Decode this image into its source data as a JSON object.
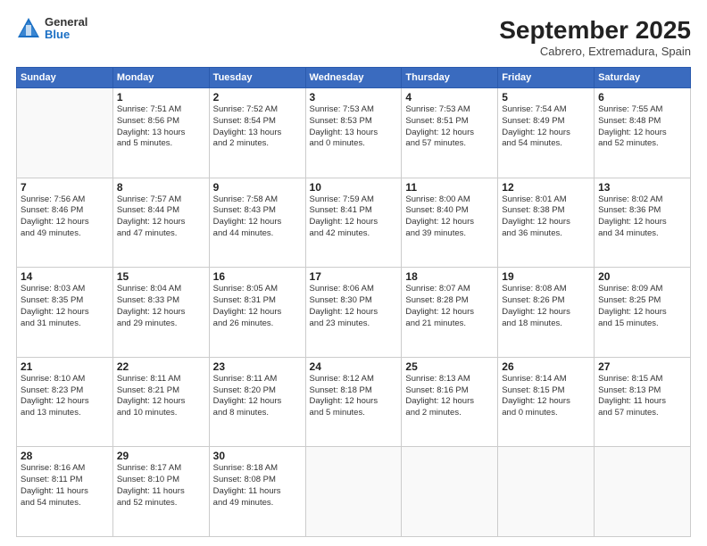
{
  "header": {
    "logo_general": "General",
    "logo_blue": "Blue",
    "month_title": "September 2025",
    "location": "Cabrero, Extremadura, Spain"
  },
  "days_of_week": [
    "Sunday",
    "Monday",
    "Tuesday",
    "Wednesday",
    "Thursday",
    "Friday",
    "Saturday"
  ],
  "weeks": [
    [
      {
        "day": "",
        "info": ""
      },
      {
        "day": "1",
        "info": "Sunrise: 7:51 AM\nSunset: 8:56 PM\nDaylight: 13 hours\nand 5 minutes."
      },
      {
        "day": "2",
        "info": "Sunrise: 7:52 AM\nSunset: 8:54 PM\nDaylight: 13 hours\nand 2 minutes."
      },
      {
        "day": "3",
        "info": "Sunrise: 7:53 AM\nSunset: 8:53 PM\nDaylight: 13 hours\nand 0 minutes."
      },
      {
        "day": "4",
        "info": "Sunrise: 7:53 AM\nSunset: 8:51 PM\nDaylight: 12 hours\nand 57 minutes."
      },
      {
        "day": "5",
        "info": "Sunrise: 7:54 AM\nSunset: 8:49 PM\nDaylight: 12 hours\nand 54 minutes."
      },
      {
        "day": "6",
        "info": "Sunrise: 7:55 AM\nSunset: 8:48 PM\nDaylight: 12 hours\nand 52 minutes."
      }
    ],
    [
      {
        "day": "7",
        "info": "Sunrise: 7:56 AM\nSunset: 8:46 PM\nDaylight: 12 hours\nand 49 minutes."
      },
      {
        "day": "8",
        "info": "Sunrise: 7:57 AM\nSunset: 8:44 PM\nDaylight: 12 hours\nand 47 minutes."
      },
      {
        "day": "9",
        "info": "Sunrise: 7:58 AM\nSunset: 8:43 PM\nDaylight: 12 hours\nand 44 minutes."
      },
      {
        "day": "10",
        "info": "Sunrise: 7:59 AM\nSunset: 8:41 PM\nDaylight: 12 hours\nand 42 minutes."
      },
      {
        "day": "11",
        "info": "Sunrise: 8:00 AM\nSunset: 8:40 PM\nDaylight: 12 hours\nand 39 minutes."
      },
      {
        "day": "12",
        "info": "Sunrise: 8:01 AM\nSunset: 8:38 PM\nDaylight: 12 hours\nand 36 minutes."
      },
      {
        "day": "13",
        "info": "Sunrise: 8:02 AM\nSunset: 8:36 PM\nDaylight: 12 hours\nand 34 minutes."
      }
    ],
    [
      {
        "day": "14",
        "info": "Sunrise: 8:03 AM\nSunset: 8:35 PM\nDaylight: 12 hours\nand 31 minutes."
      },
      {
        "day": "15",
        "info": "Sunrise: 8:04 AM\nSunset: 8:33 PM\nDaylight: 12 hours\nand 29 minutes."
      },
      {
        "day": "16",
        "info": "Sunrise: 8:05 AM\nSunset: 8:31 PM\nDaylight: 12 hours\nand 26 minutes."
      },
      {
        "day": "17",
        "info": "Sunrise: 8:06 AM\nSunset: 8:30 PM\nDaylight: 12 hours\nand 23 minutes."
      },
      {
        "day": "18",
        "info": "Sunrise: 8:07 AM\nSunset: 8:28 PM\nDaylight: 12 hours\nand 21 minutes."
      },
      {
        "day": "19",
        "info": "Sunrise: 8:08 AM\nSunset: 8:26 PM\nDaylight: 12 hours\nand 18 minutes."
      },
      {
        "day": "20",
        "info": "Sunrise: 8:09 AM\nSunset: 8:25 PM\nDaylight: 12 hours\nand 15 minutes."
      }
    ],
    [
      {
        "day": "21",
        "info": "Sunrise: 8:10 AM\nSunset: 8:23 PM\nDaylight: 12 hours\nand 13 minutes."
      },
      {
        "day": "22",
        "info": "Sunrise: 8:11 AM\nSunset: 8:21 PM\nDaylight: 12 hours\nand 10 minutes."
      },
      {
        "day": "23",
        "info": "Sunrise: 8:11 AM\nSunset: 8:20 PM\nDaylight: 12 hours\nand 8 minutes."
      },
      {
        "day": "24",
        "info": "Sunrise: 8:12 AM\nSunset: 8:18 PM\nDaylight: 12 hours\nand 5 minutes."
      },
      {
        "day": "25",
        "info": "Sunrise: 8:13 AM\nSunset: 8:16 PM\nDaylight: 12 hours\nand 2 minutes."
      },
      {
        "day": "26",
        "info": "Sunrise: 8:14 AM\nSunset: 8:15 PM\nDaylight: 12 hours\nand 0 minutes."
      },
      {
        "day": "27",
        "info": "Sunrise: 8:15 AM\nSunset: 8:13 PM\nDaylight: 11 hours\nand 57 minutes."
      }
    ],
    [
      {
        "day": "28",
        "info": "Sunrise: 8:16 AM\nSunset: 8:11 PM\nDaylight: 11 hours\nand 54 minutes."
      },
      {
        "day": "29",
        "info": "Sunrise: 8:17 AM\nSunset: 8:10 PM\nDaylight: 11 hours\nand 52 minutes."
      },
      {
        "day": "30",
        "info": "Sunrise: 8:18 AM\nSunset: 8:08 PM\nDaylight: 11 hours\nand 49 minutes."
      },
      {
        "day": "",
        "info": ""
      },
      {
        "day": "",
        "info": ""
      },
      {
        "day": "",
        "info": ""
      },
      {
        "day": "",
        "info": ""
      }
    ]
  ]
}
